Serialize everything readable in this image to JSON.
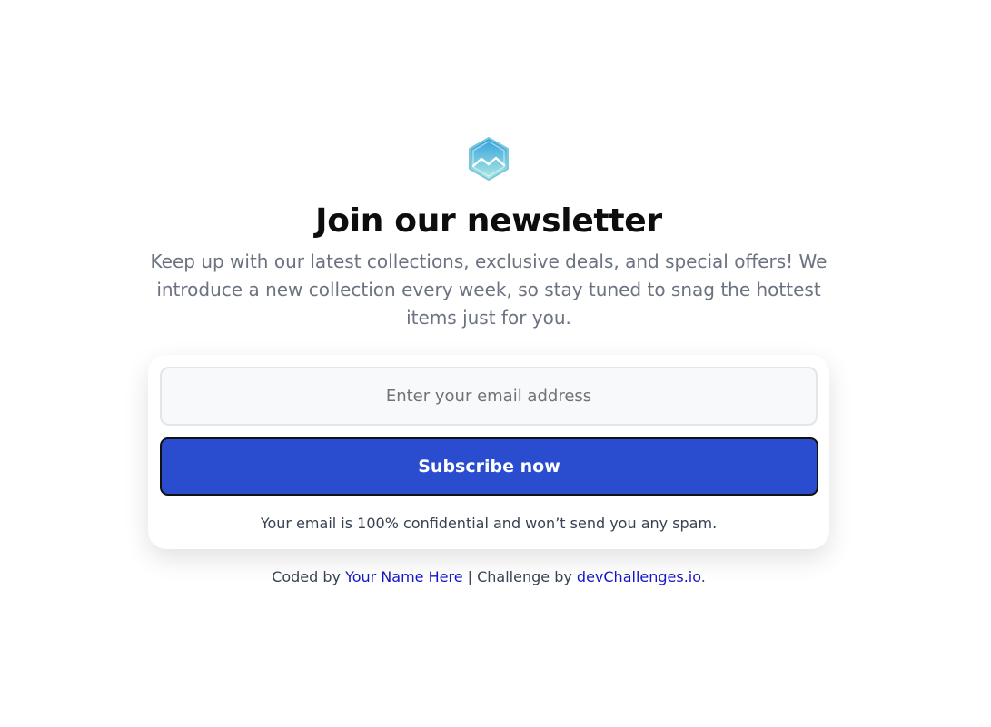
{
  "logo": {
    "icon": "mountain-hexagon-icon",
    "colors": {
      "top": "#3ba7dc",
      "bottom": "#a8e6e0",
      "outline": "#7fc6d8"
    }
  },
  "header": {
    "title": "Join our newsletter",
    "intro": "Keep up with our latest collections, exclusive deals, and special offers! We introduce a new collection every week, so stay tuned to snag the hottest items just for you."
  },
  "form": {
    "email_placeholder": "Enter your email address",
    "email_value": "",
    "subscribe_label": "Subscribe now",
    "confidential_note": "Your email is 100% confidential and won’t send you any spam."
  },
  "footer": {
    "coded_by_prefix": "Coded by ",
    "author_link": "Your Name Here",
    "separator": " | Challenge by ",
    "challenge_link": "devChallenges.io",
    "suffix": "."
  },
  "colors": {
    "accent": "#2a4ccf",
    "link": "#1515c8",
    "muted_text": "#6b7280"
  }
}
